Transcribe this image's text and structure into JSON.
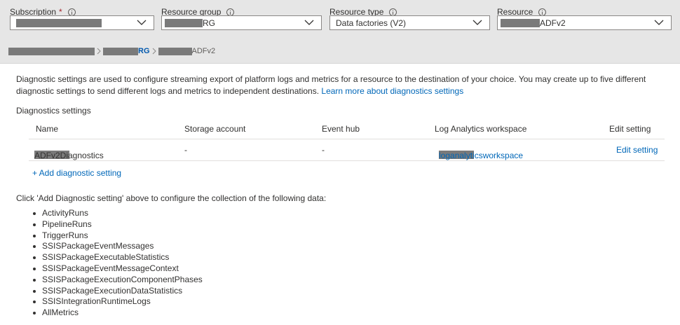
{
  "filters": {
    "subscription": {
      "label": "Subscription",
      "required_mark": "*",
      "value": ""
    },
    "resource_group": {
      "label": "Resource group",
      "value": "RG"
    },
    "resource_type": {
      "label": "Resource type",
      "value": "Data factories (V2)"
    },
    "resource": {
      "label": "Resource",
      "value": "ADFv2"
    }
  },
  "breadcrumb": {
    "rg": "RG",
    "resource": "ADFv2"
  },
  "description": {
    "text": "Diagnostic settings are used to configure streaming export of platform logs and metrics for a resource to the destination of your choice. You may create up to five different diagnostic settings to send different logs and metrics to independent destinations.",
    "link": "Learn more about diagnostics settings"
  },
  "diagnostics": {
    "title": "Diagnostics settings",
    "columns": [
      "Name",
      "Storage account",
      "Event hub",
      "Log Analytics workspace",
      "Edit setting"
    ],
    "rows": [
      {
        "name": "ADFv2Diagnostics",
        "storage": "-",
        "eventhub": "-",
        "workspace": "loganalyticsworkspace",
        "edit": "Edit setting"
      }
    ],
    "add_label": "+ Add diagnostic setting"
  },
  "collection": {
    "intro": "Click 'Add Diagnostic setting' above to configure the collection of the following data:",
    "items": [
      "ActivityRuns",
      "PipelineRuns",
      "TriggerRuns",
      "SSISPackageEventMessages",
      "SSISPackageExecutableStatistics",
      "SSISPackageEventMessageContext",
      "SSISPackageExecutionComponentPhases",
      "SSISPackageExecutionDataStatistics",
      "SSISIntegrationRuntimeLogs",
      "AllMetrics"
    ]
  },
  "colors": {
    "link": "#0067b8",
    "band": "#e6e6e6",
    "required": "#a4262c"
  }
}
